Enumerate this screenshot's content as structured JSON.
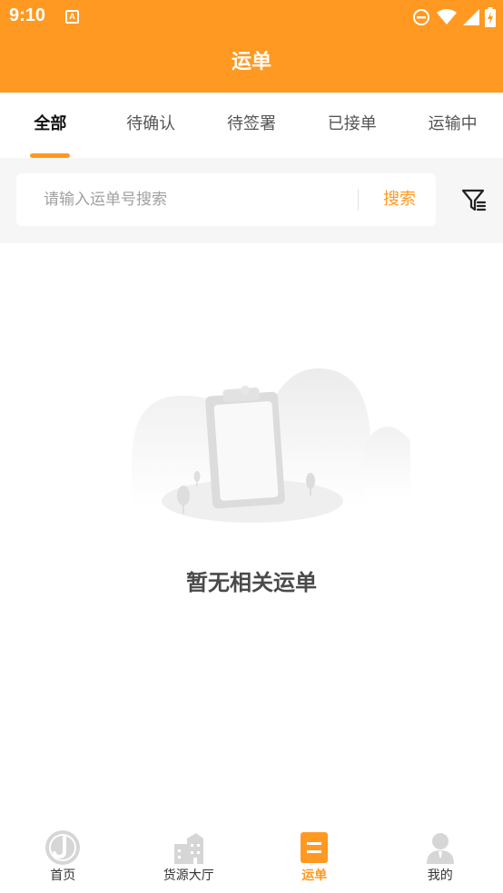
{
  "status_bar": {
    "time": "9:10",
    "notification_glyph": "A",
    "icons": [
      "do-not-disturb-icon",
      "wifi-icon",
      "signal-icon",
      "battery-charging-icon"
    ]
  },
  "header": {
    "title": "运单"
  },
  "tabs": [
    {
      "label": "全部",
      "active": true
    },
    {
      "label": "待确认",
      "active": false
    },
    {
      "label": "待签署",
      "active": false
    },
    {
      "label": "已接单",
      "active": false
    },
    {
      "label": "运输中",
      "active": false
    }
  ],
  "search": {
    "placeholder": "请输入运单号搜索",
    "value": "",
    "button_label": "搜索",
    "filter_icon": "filter-icon"
  },
  "empty_state": {
    "illustration": "empty-clipboard-illustration",
    "message": "暂无相关运单"
  },
  "bottom_nav": [
    {
      "label": "首页",
      "icon": "home-logo-icon",
      "active": false
    },
    {
      "label": "货源大厅",
      "icon": "buildings-icon",
      "active": false
    },
    {
      "label": "运单",
      "icon": "waybill-icon",
      "active": true
    },
    {
      "label": "我的",
      "icon": "person-icon",
      "active": false
    }
  ],
  "colors": {
    "brand": "#ff9921",
    "page_bg": "#ffffff",
    "search_bg": "#f6f6f6",
    "inactive_icon": "#d6d6d6"
  }
}
